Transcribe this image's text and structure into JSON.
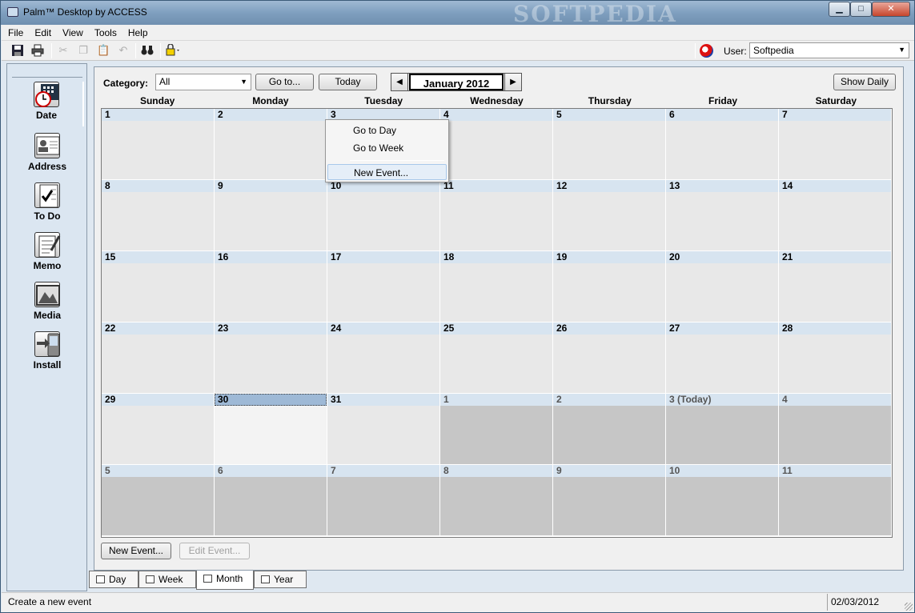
{
  "window": {
    "title": "Palm™ Desktop by ACCESS",
    "watermark": "SOFTPEDIA",
    "controls": {
      "minimize": "▁",
      "maximize": "□",
      "close": "✕"
    }
  },
  "menubar": {
    "items": [
      "File",
      "Edit",
      "View",
      "Tools",
      "Help"
    ]
  },
  "toolbar": {
    "user_label": "User:",
    "user_value": "Softpedia"
  },
  "leftnav": {
    "items": [
      {
        "label": "Date",
        "icon": "calendar-clock-icon"
      },
      {
        "label": "Address",
        "icon": "address-card-icon"
      },
      {
        "label": "To Do",
        "icon": "todo-checklist-icon"
      },
      {
        "label": "Memo",
        "icon": "memo-notepad-icon"
      },
      {
        "label": "Media",
        "icon": "media-picture-icon"
      },
      {
        "label": "Install",
        "icon": "install-handheld-icon"
      }
    ]
  },
  "main": {
    "category_label": "Category:",
    "category_value": "All",
    "goto_label": "Go to...",
    "today_label": "Today",
    "month_label": "January 2012",
    "show_daily_label": "Show Daily",
    "weekdays": [
      "Sunday",
      "Monday",
      "Tuesday",
      "Wednesday",
      "Thursday",
      "Friday",
      "Saturday"
    ],
    "weeks": [
      [
        "1",
        "2",
        "3",
        "4",
        "5",
        "6",
        "7"
      ],
      [
        "8",
        "9",
        "10",
        "11",
        "12",
        "13",
        "14"
      ],
      [
        "15",
        "16",
        "17",
        "18",
        "19",
        "20",
        "21"
      ],
      [
        "22",
        "23",
        "24",
        "25",
        "26",
        "27",
        "28"
      ],
      [
        "29",
        "30",
        "31",
        "1",
        "2",
        "3 (Today)",
        "4"
      ],
      [
        "5",
        "6",
        "7",
        "8",
        "9",
        "10",
        "11"
      ]
    ],
    "new_event_label": "New Event...",
    "edit_event_label": "Edit Event..."
  },
  "context_menu": {
    "items": [
      "Go to Day",
      "Go to Week",
      "New Event..."
    ]
  },
  "tabs": [
    "Day",
    "Week",
    "Month",
    "Year"
  ],
  "statusbar": {
    "text": "Create a new event",
    "date": "02/03/2012"
  }
}
